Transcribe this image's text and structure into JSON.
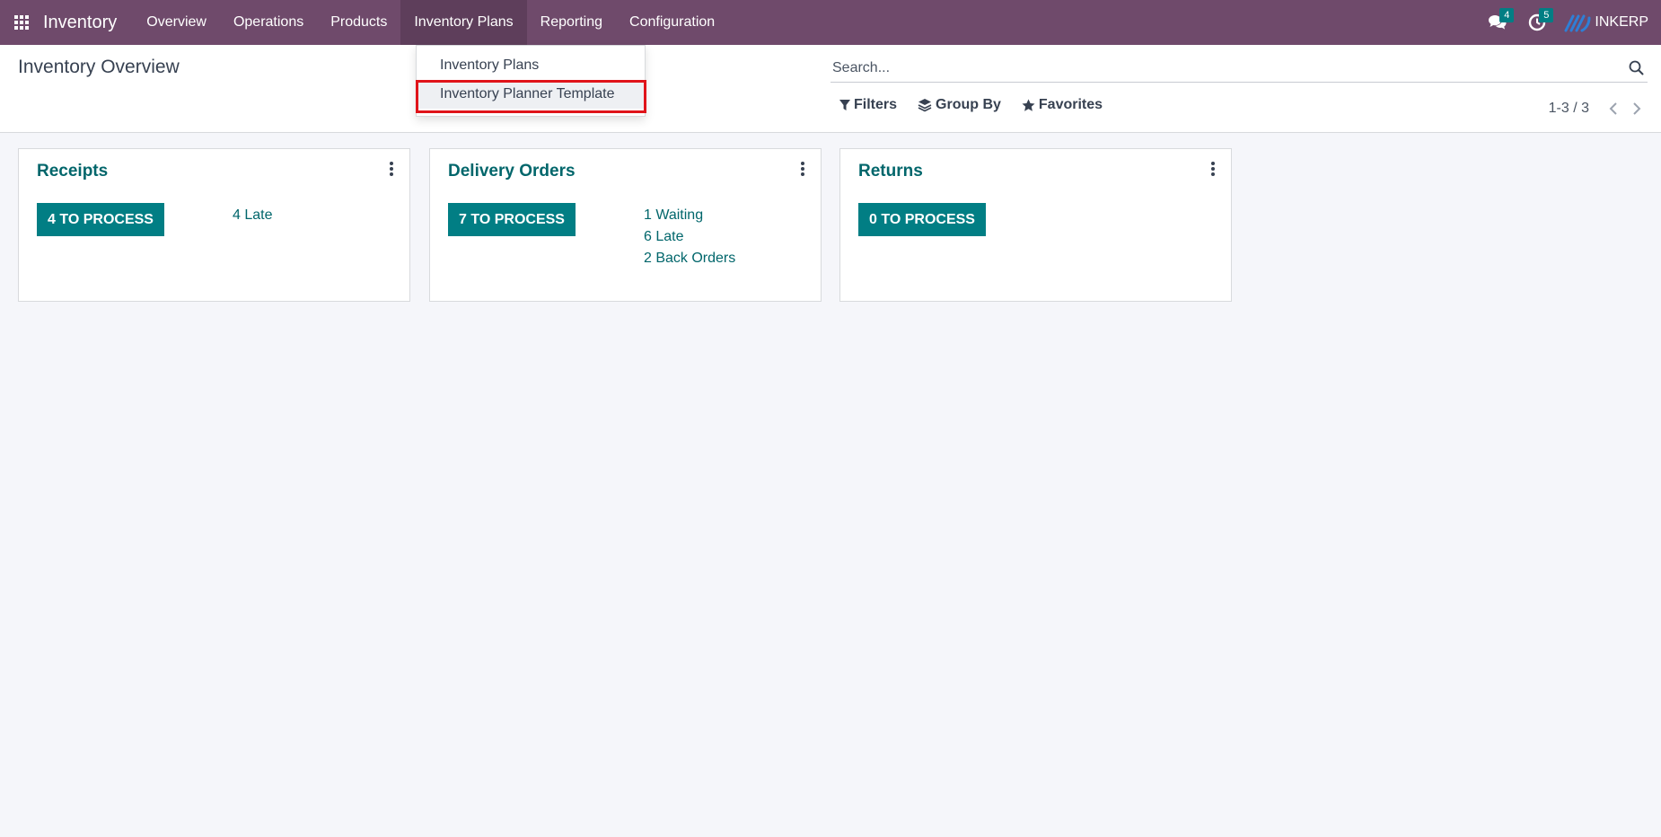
{
  "app": {
    "title": "Inventory"
  },
  "nav": {
    "items": [
      {
        "label": "Overview"
      },
      {
        "label": "Operations"
      },
      {
        "label": "Products"
      },
      {
        "label": "Inventory Plans"
      },
      {
        "label": "Reporting"
      },
      {
        "label": "Configuration"
      }
    ],
    "active_index": 3
  },
  "systray": {
    "messages_count": "4",
    "activities_count": "5",
    "company": "INKERP"
  },
  "dropdown": {
    "items": [
      {
        "label": "Inventory Plans"
      },
      {
        "label": "Inventory Planner Template"
      }
    ]
  },
  "control_panel": {
    "breadcrumb": "Inventory Overview",
    "search_placeholder": "Search...",
    "filters_label": "Filters",
    "group_by_label": "Group By",
    "favorites_label": "Favorites",
    "pager": "1-3 / 3"
  },
  "cards": [
    {
      "title": "Receipts",
      "button": "4 TO PROCESS",
      "links": [
        "4 Late"
      ]
    },
    {
      "title": "Delivery Orders",
      "button": "7 TO PROCESS",
      "links": [
        "1 Waiting",
        "6 Late",
        "2 Back Orders"
      ]
    },
    {
      "title": "Returns",
      "button": "0 TO PROCESS",
      "links": []
    }
  ],
  "colors": {
    "navbar": "#6f4a6b",
    "accent": "#017e84",
    "link": "#01666b",
    "highlight": "#e0141a"
  }
}
